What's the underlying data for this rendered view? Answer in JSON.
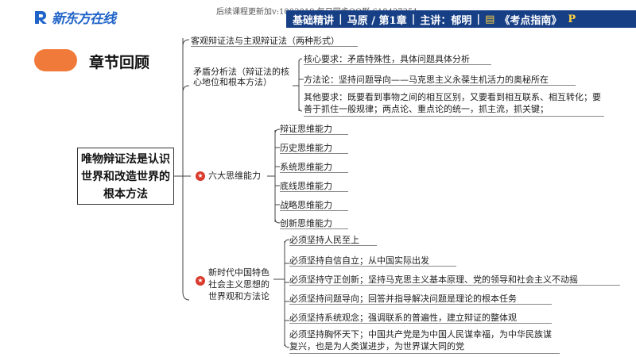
{
  "header": {
    "logo_text": "新东方在线",
    "watermark": "后续课程更新加v:1003019     每日同步QQ群:618427351",
    "banner": [
      "基础精讲",
      "|",
      "马原 / 第1章",
      "|",
      "主讲：郁明",
      "|",
      "《考点指南》"
    ],
    "banner_mark": "P"
  },
  "review": {
    "title": "章节回顾"
  },
  "root": {
    "label": "唯物辩证法是认识世界和改造世界的根本方法"
  },
  "branches": {
    "b1": {
      "label": "客观辩证法与主观辩证法（两种形式）"
    },
    "b2": {
      "label": "矛盾分析法（辩证法的核心地位和根本方法）",
      "children": [
        "核心要求：矛盾特殊性，具体问题具体分析",
        "方法论：坚持问题导向——马克思主义永葆生机活力的奥秘所在",
        "其他要求：既要看到事物之间的相互区别，又要看到相互联系、相互转化；要善于抓住一般规律；两点论、重点论的统一，抓主流，抓关键；"
      ]
    },
    "b3": {
      "label": "六大思维能力",
      "children": [
        "辩证思维能力",
        "历史思维能力",
        "系统思维能力",
        "底线思维能力",
        "战略思维能力",
        "创新思维能力"
      ]
    },
    "b4": {
      "label": "新时代中国特色社会主义思想的世界观和方法论",
      "children": [
        "必须坚持人民至上",
        "必须坚持自信自立；从中国实际出发",
        "必须坚持守正创新；坚持马克思主义基本原理、党的领导和社会主义不动摇",
        "必须坚持问题导向；回答并指导解决问题是理论的根本任务",
        "必须坚持系统观念；强调联系的普遍性，建立辩证的整体观",
        "必须坚持胸怀天下；中国共产党是为中国人民谋幸福，为中华民族谋复兴，也是为人类谋进步，为世界谋大同的党"
      ]
    }
  }
}
